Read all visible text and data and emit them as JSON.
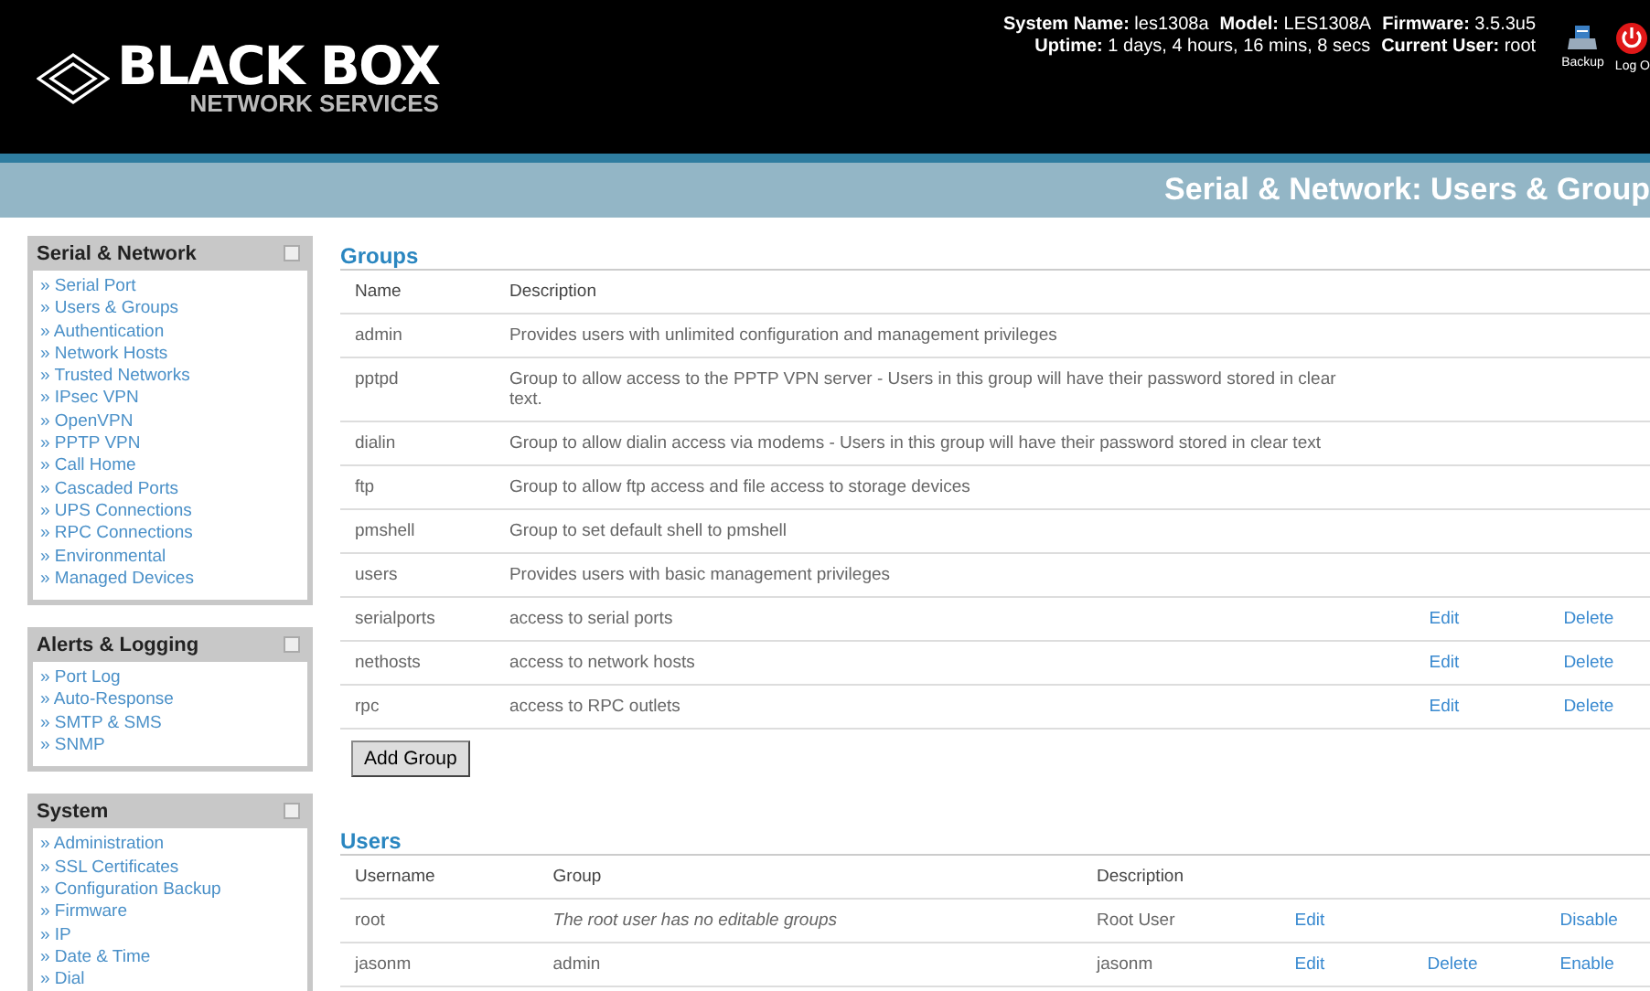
{
  "header": {
    "logo": {
      "name": "BLACK BOX",
      "tagline": "NETWORK SERVICES"
    },
    "info_lines": [
      [
        {
          "label": "System Name:",
          "value": "les1308a"
        },
        {
          "label": "Model:",
          "value": "LES1308A"
        },
        {
          "label": "Firmware:",
          "value": "3.5.3u5"
        }
      ],
      [
        {
          "label": "Uptime:",
          "value": "1 days, 4 hours, 16 mins, 8 secs"
        },
        {
          "label": "Current User:",
          "value": "root"
        }
      ]
    ],
    "actions": [
      {
        "kind": "backup",
        "label": "Backup"
      },
      {
        "kind": "logout",
        "label": "Log O"
      }
    ]
  },
  "page_title": "Serial & Network: Users & Group",
  "sidebar": [
    {
      "title": "Serial & Network",
      "items": [
        "» Serial Port",
        "» Users & Groups",
        "» Authentication",
        "» Network Hosts",
        "» Trusted Networks",
        "» IPsec VPN",
        "» OpenVPN",
        "» PPTP VPN",
        "» Call Home",
        "» Cascaded Ports",
        "» UPS Connections",
        "» RPC Connections",
        "» Environmental",
        "» Managed Devices"
      ]
    },
    {
      "title": "Alerts & Logging",
      "items": [
        "» Port Log",
        "» Auto-Response",
        "» SMTP & SMS",
        "» SNMP"
      ]
    },
    {
      "title": "System",
      "items": [
        "» Administration",
        "» SSL Certificates",
        "» Configuration Backup",
        "» Firmware",
        "» IP",
        "» Date & Time",
        "» Dial"
      ]
    }
  ],
  "groups": {
    "title": "Groups",
    "columns": [
      "Name",
      "Description"
    ],
    "rows": [
      {
        "name": "admin",
        "description": "Provides users with unlimited configuration and management privileges"
      },
      {
        "name": "pptpd",
        "description": "Group to allow access to the PPTP VPN server - Users in this group will have their password stored in clear text."
      },
      {
        "name": "dialin",
        "description": "Group to allow dialin access via modems - Users in this group will have their password stored in clear text"
      },
      {
        "name": "ftp",
        "description": "Group to allow ftp access and file access to storage devices"
      },
      {
        "name": "pmshell",
        "description": "Group to set default shell to pmshell"
      },
      {
        "name": "users",
        "description": "Provides users with basic management privileges"
      },
      {
        "name": "serialports",
        "description": "access to serial ports",
        "edit": "Edit",
        "delete": "Delete"
      },
      {
        "name": "nethosts",
        "description": "access to network hosts",
        "edit": "Edit",
        "delete": "Delete"
      },
      {
        "name": "rpc",
        "description": "access to RPC outlets",
        "edit": "Edit",
        "delete": "Delete"
      }
    ],
    "add_button": "Add Group"
  },
  "users": {
    "title": "Users",
    "columns": [
      "Username",
      "Group",
      "Description"
    ],
    "rows": [
      {
        "username": "root",
        "group": "The root user has no editable groups",
        "group_italic": true,
        "description": "Root User",
        "edit": "Edit",
        "toggle": "Disable"
      },
      {
        "username": "jasonm",
        "group": "admin",
        "group_italic": false,
        "description": "jasonm",
        "edit": "Edit",
        "delete": "Delete",
        "toggle": "Enable"
      }
    ]
  }
}
